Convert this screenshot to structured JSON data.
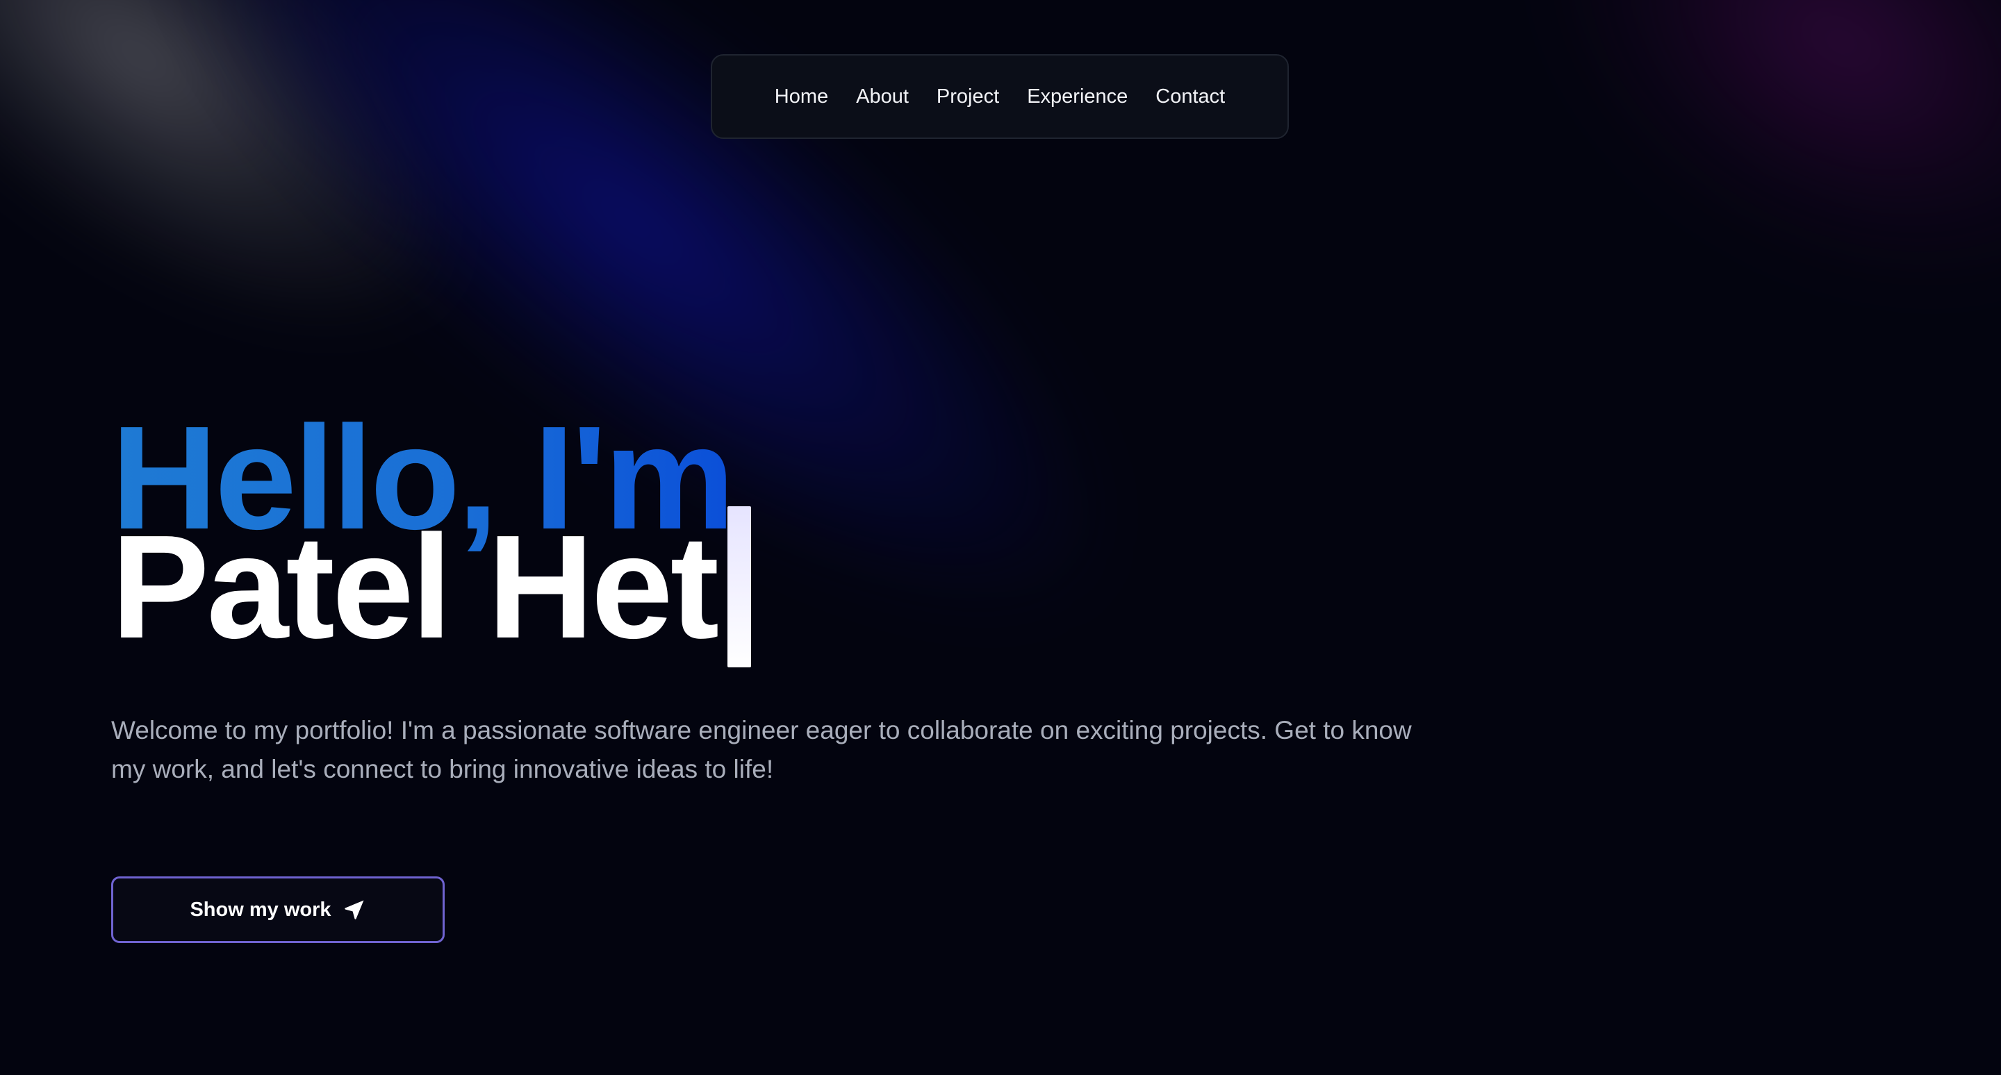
{
  "nav": {
    "items": [
      {
        "label": "Home"
      },
      {
        "label": "About"
      },
      {
        "label": "Project"
      },
      {
        "label": "Experience"
      },
      {
        "label": "Contact"
      }
    ]
  },
  "hero": {
    "greeting": "Hello, I'm",
    "name": "Patel Het",
    "intro": "Welcome to my portfolio! I'm a passionate software engineer eager to collaborate on exciting projects. Get to know my work, and let's connect to bring innovative ideas to life!",
    "cta_label": "Show my work",
    "cta_icon": "send-icon"
  },
  "colors": {
    "background": "#03040f",
    "greeting_gradient_start": "#1e7ad4",
    "greeting_gradient_end": "#0b4fd8",
    "cta_border": "#6f63d0",
    "intro_text": "#a9aebb"
  }
}
